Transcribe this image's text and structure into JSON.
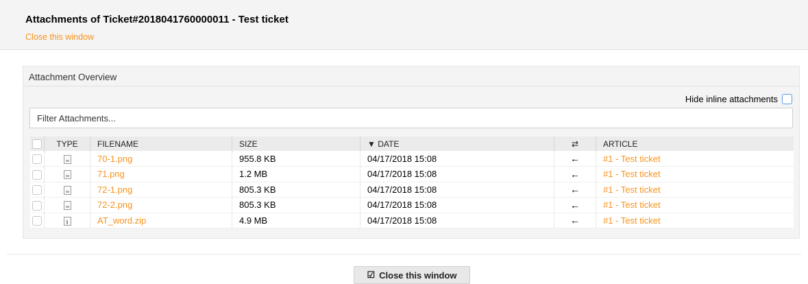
{
  "header": {
    "title": "Attachments of Ticket#2018041760000011 - Test ticket",
    "close_link": "Close this window"
  },
  "panel": {
    "title": "Attachment Overview",
    "hide_inline_label": "Hide inline attachments",
    "filter_placeholder": "Filter Attachments..."
  },
  "table": {
    "columns": {
      "type": "TYPE",
      "filename": "FILENAME",
      "size": "SIZE",
      "date": "▼ DATE",
      "swap": "⇄",
      "article": "ARTICLE"
    },
    "rows": [
      {
        "filename": "70-1.png",
        "size": "955.8 KB",
        "date": "04/17/2018 15:08",
        "direction": "←",
        "article": "#1 - Test ticket",
        "icon": "image-file-icon"
      },
      {
        "filename": "71.png",
        "size": "1.2 MB",
        "date": "04/17/2018 15:08",
        "direction": "←",
        "article": "#1 - Test ticket",
        "icon": "image-file-icon"
      },
      {
        "filename": "72-1.png",
        "size": "805.3 KB",
        "date": "04/17/2018 15:08",
        "direction": "←",
        "article": "#1 - Test ticket",
        "icon": "image-file-icon"
      },
      {
        "filename": "72-2.png",
        "size": "805.3 KB",
        "date": "04/17/2018 15:08",
        "direction": "←",
        "article": "#1 - Test ticket",
        "icon": "image-file-icon"
      },
      {
        "filename": "AT_word.zip",
        "size": "4.9 MB",
        "date": "04/17/2018 15:08",
        "direction": "←",
        "article": "#1 - Test ticket",
        "icon": "zip-file-icon"
      }
    ]
  },
  "footer": {
    "close_button": "Close this window",
    "close_button_icon": "☑"
  },
  "colors": {
    "link": "#f7931e",
    "checkbox_accent": "#5b9be6"
  }
}
